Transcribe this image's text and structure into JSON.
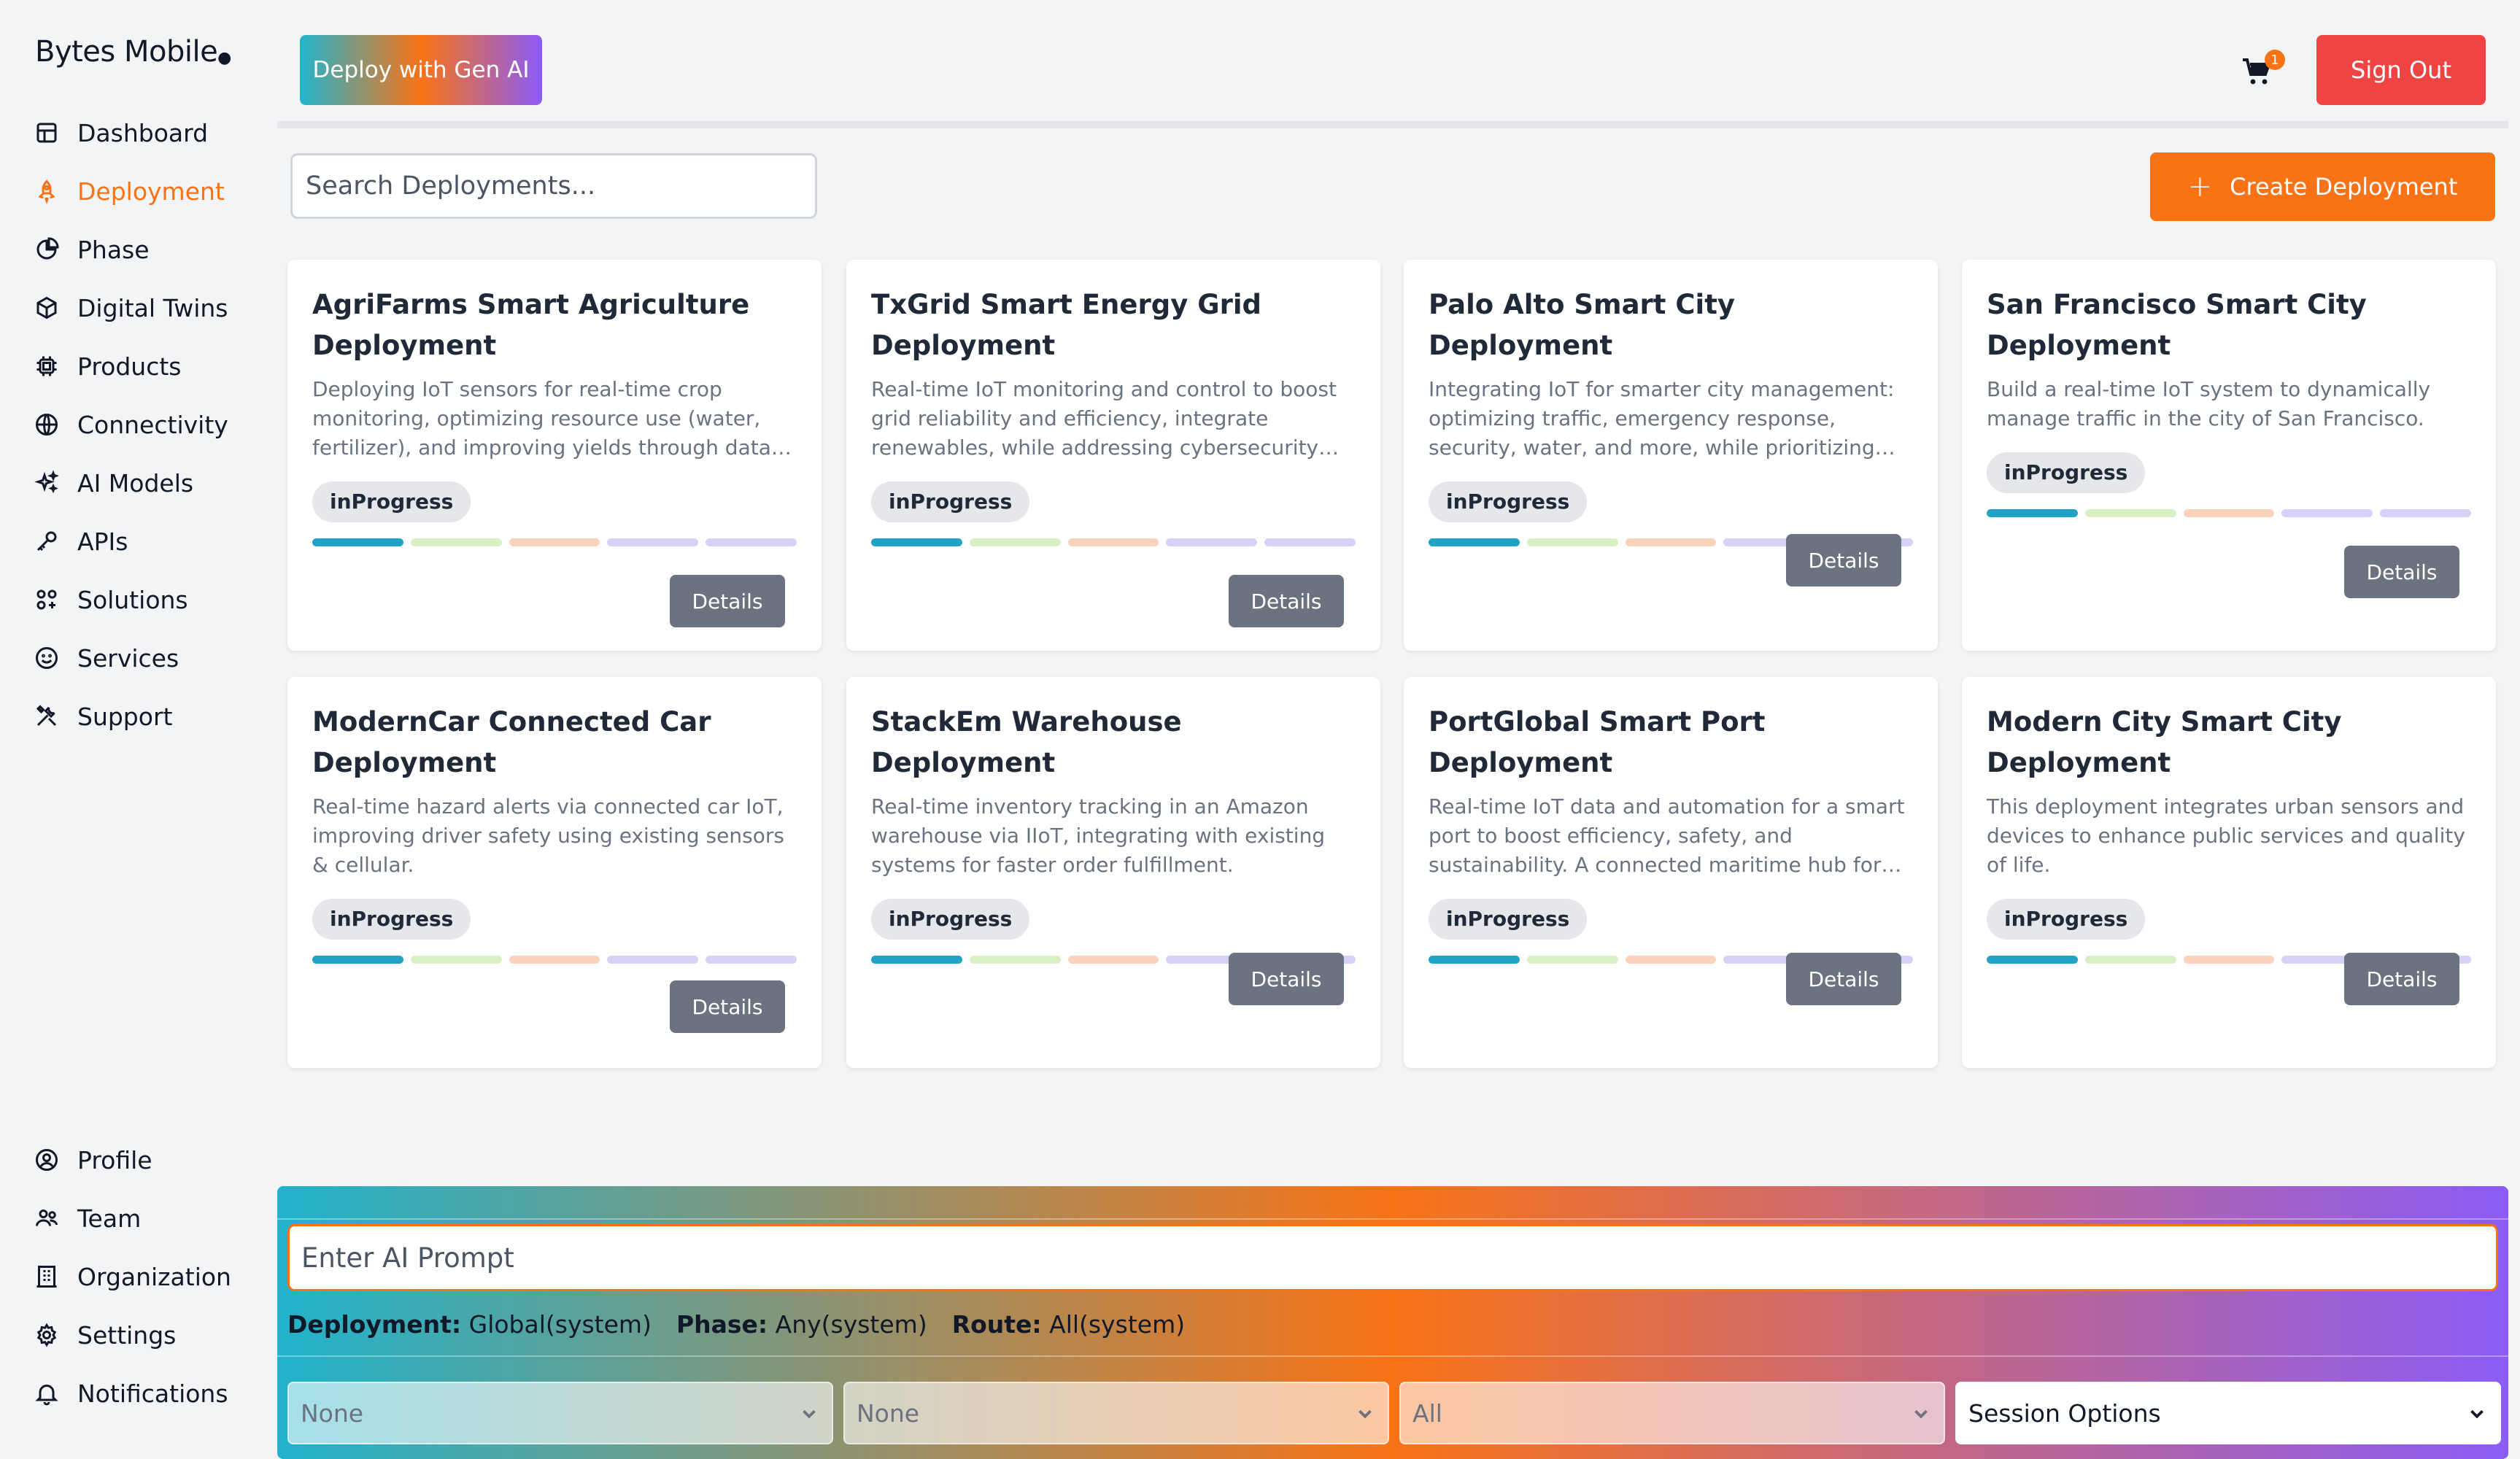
{
  "brand": {
    "name": "Bytes Mobile",
    "mark": "●"
  },
  "sidebar": {
    "top_items": [
      {
        "label": "Dashboard",
        "icon": "dashboard-icon"
      },
      {
        "label": "Deployment",
        "icon": "rocket-icon",
        "active": true
      },
      {
        "label": "Phase",
        "icon": "pie-chart-icon"
      },
      {
        "label": "Digital Twins",
        "icon": "cube-icon"
      },
      {
        "label": "Products",
        "icon": "chip-icon"
      },
      {
        "label": "Connectivity",
        "icon": "globe-icon"
      },
      {
        "label": "AI Models",
        "icon": "sparkles-icon"
      },
      {
        "label": "APIs",
        "icon": "key-icon"
      },
      {
        "label": "Solutions",
        "icon": "grid-plus-icon"
      },
      {
        "label": "Services",
        "icon": "smile-icon"
      },
      {
        "label": "Support",
        "icon": "tools-icon"
      }
    ],
    "bottom_items": [
      {
        "label": "Profile",
        "icon": "user-circle-icon"
      },
      {
        "label": "Team",
        "icon": "users-icon"
      },
      {
        "label": "Organization",
        "icon": "building-icon"
      },
      {
        "label": "Settings",
        "icon": "gear-icon"
      },
      {
        "label": "Notifications",
        "icon": "bell-icon"
      }
    ]
  },
  "header": {
    "genai_label": "Deploy with Gen AI",
    "cart_count": "1",
    "signout_label": "Sign Out"
  },
  "toolbar": {
    "search_placeholder": "Search Deployments...",
    "create_label": "Create Deployment"
  },
  "cards": [
    {
      "title": "AgriFarms Smart Agriculture Deployment",
      "description": "Deploying IoT sensors for real-time crop monitoring, optimizing resource use (water, fertilizer), and improving yields through data-driven insights.",
      "status": "inProgress",
      "button": "Details"
    },
    {
      "title": "TxGrid Smart Energy Grid Deployment",
      "description": "Real-time IoT monitoring and control to boost grid reliability and efficiency, integrate renewables, while addressing cybersecurity risks.",
      "status": "inProgress",
      "button": "Details"
    },
    {
      "title": "Palo Alto Smart City Deployment",
      "description": "Integrating IoT for smarter city management: optimizing traffic, emergency response, security, water, and more, while prioritizing privacy.",
      "status": "inProgress",
      "button": "Details"
    },
    {
      "title": "San Francisco Smart City Deployment",
      "description": "Build a real-time IoT system to dynamically manage traffic in the city of San Francisco.",
      "status": "inProgress",
      "button": "Details"
    },
    {
      "title": "ModernCar Connected Car Deployment",
      "description": "Real-time hazard alerts via connected car IoT, improving driver safety using existing sensors & cellular.",
      "status": "inProgress",
      "button": "Details"
    },
    {
      "title": "StackEm Warehouse Deployment",
      "description": "Real-time inventory tracking in an Amazon warehouse via IIoT, integrating with existing systems for faster order fulfillment.",
      "status": "inProgress",
      "button": "Details"
    },
    {
      "title": "PortGlobal Smart Port Deployment",
      "description": "Real-time IoT data and automation for a smart port to boost efficiency, safety, and sustainability. A connected maritime hub for the future.",
      "status": "inProgress",
      "button": "Details"
    },
    {
      "title": "Modern City Smart City Deployment",
      "description": "This deployment integrates urban sensors and devices to enhance public services and quality of life.",
      "status": "inProgress",
      "button": "Details"
    }
  ],
  "ai_panel": {
    "prompt_placeholder": "Enter AI Prompt",
    "context": [
      {
        "key": "Deployment:",
        "value": "Global(system)"
      },
      {
        "key": "Phase:",
        "value": "Any(system)"
      },
      {
        "key": "Route:",
        "value": "All(system)"
      }
    ],
    "selects": [
      "None",
      "None",
      "All",
      "Session Options"
    ]
  },
  "colors": {
    "accent": "#f97316",
    "danger": "#ef4444",
    "gradient_start": "#22b5cc",
    "gradient_end": "#8b5cf6"
  }
}
